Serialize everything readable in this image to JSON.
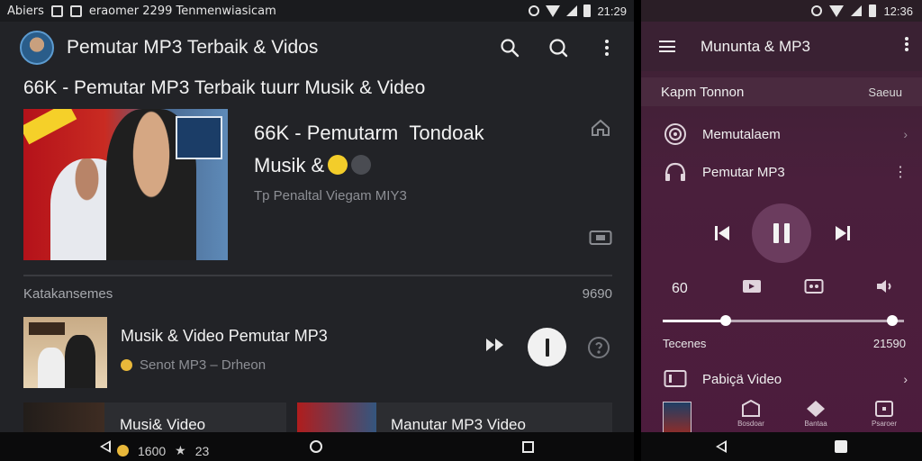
{
  "left_status": {
    "carrier_text": "Abiers",
    "notification_text": "eraomer 2299 Tenmenwiasicam",
    "time": "21:29"
  },
  "left_appbar": {
    "title": "Pemutar MP3 Terbaik & Vidos"
  },
  "page_heading": "66K - Pemutar MP3 Terbaik tuurr Musik & Video",
  "hero": {
    "title_line1": "66K - Pemutarm  Tondoak",
    "title_line2": "Musik &",
    "subtitle": "Tp Penaltal Viegam MIY3"
  },
  "section": {
    "label": "Katakansemes",
    "count": "9690"
  },
  "track": {
    "title": "Musik & Video  Pemutar MP3",
    "meta": "Senot MP3 – Drheon"
  },
  "cards": [
    {
      "label": "Musi& Video",
      "meta": "1600",
      "meta2": "23"
    },
    {
      "label": "Manutar MP3 Video"
    }
  ],
  "right_status": {
    "time": "12:36"
  },
  "right_appbar": {
    "title": "Mununta & MP3"
  },
  "right_section": {
    "label": "Kapm Tonnon",
    "right": "Saeuu"
  },
  "right_items": [
    {
      "label": "Memutalaem"
    },
    {
      "label": "Pemutar MP3"
    }
  ],
  "player": {
    "counter": "60",
    "progress": 0.95,
    "buffer": 0.26,
    "time_start": "Tecenes",
    "time_end": "21590"
  },
  "right_video_item": {
    "label": "Pabiçä Video"
  },
  "bottom_tabs": [
    "Bosdoar",
    "Bantaa",
    "Psaroer"
  ],
  "colors": {
    "left_bg": "#222327",
    "right_bg": "#4a1f3c",
    "accent_play": "#f1f1f1"
  }
}
